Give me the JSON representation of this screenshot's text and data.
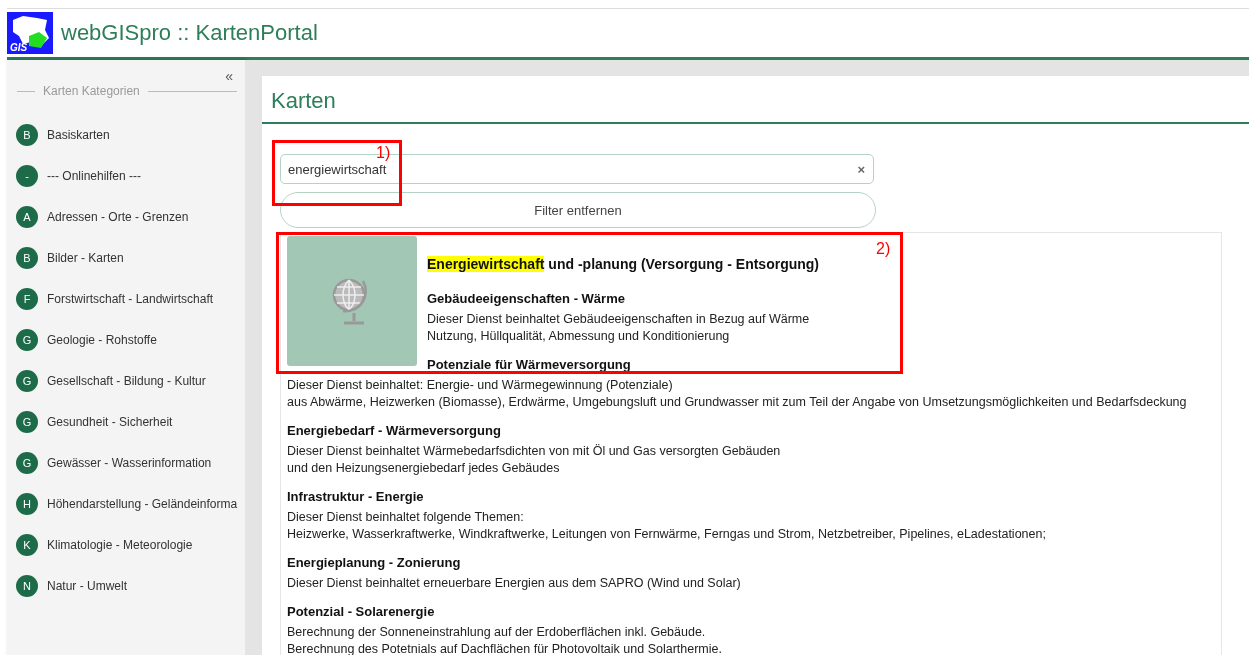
{
  "header": {
    "logo_text": "GIS",
    "title": "webGISpro :: KartenPortal"
  },
  "sidebar": {
    "collapse": "«",
    "heading": "Karten Kategorien",
    "items": [
      {
        "badge": "B",
        "label": "Basiskarten"
      },
      {
        "badge": "-",
        "label": "--- Onlinehilfen ---"
      },
      {
        "badge": "A",
        "label": "Adressen - Orte - Grenzen"
      },
      {
        "badge": "B",
        "label": "Bilder - Karten"
      },
      {
        "badge": "F",
        "label": "Forstwirtschaft - Landwirtschaft"
      },
      {
        "badge": "G",
        "label": "Geologie - Rohstoffe"
      },
      {
        "badge": "G",
        "label": "Gesellschaft - Bildung - Kultur"
      },
      {
        "badge": "G",
        "label": "Gesundheit - Sicherheit"
      },
      {
        "badge": "G",
        "label": "Gewässer - Wasserinformation"
      },
      {
        "badge": "H",
        "label": "Höhendarstellung - Geländeinforma"
      },
      {
        "badge": "K",
        "label": "Klimatologie - Meteorologie"
      },
      {
        "badge": "N",
        "label": "Natur - Umwelt"
      }
    ]
  },
  "main": {
    "title": "Karten",
    "search": {
      "value": "energiewirtschaft",
      "clear": "×"
    },
    "filter_button": "Filter entfernen",
    "result": {
      "title_highlight": "Energiewirtschaft",
      "title_rest": " und -planung (Versorgung - Entsorgung)",
      "sections": [
        {
          "heading": "Gebäudeeigenschaften - Wärme",
          "lines": [
            "Dieser Dienst beinhaltet Gebäudeeigenschaften in Bezug auf Wärme",
            "Nutzung, Hüllqualität, Abmessung und Konditionierung"
          ]
        },
        {
          "heading": "Potenziale für Wärmeversorgung",
          "lines": [
            "Dieser Dienst beinhaltet: Energie- und Wärmegewinnung (Potenziale)",
            "aus Abwärme, Heizwerken (Biomasse), Erdwärme, Umgebungsluft und Grundwasser mit zum Teil der Angabe von Umsetzungsmöglichkeiten und Bedarfsdeckung"
          ]
        },
        {
          "heading": "Energiebedarf - Wärmeversorgung",
          "lines": [
            "Dieser Dienst beinhaltet Wärmebedarfsdichten von mit Öl und Gas versorgten Gebäuden",
            "und den Heizungsenergiebedarf jedes Gebäudes"
          ]
        },
        {
          "heading": "Infrastruktur - Energie",
          "lines": [
            "Dieser Dienst beinhaltet folgende Themen:",
            "Heizwerke, Wasserkraftwerke, Windkraftwerke, Leitungen von Fernwärme, Ferngas und Strom, Netzbetreiber, Pipelines, eLadestationen;"
          ]
        },
        {
          "heading": "Energieplanung - Zonierung",
          "lines": [
            "Dieser Dienst beinhaltet erneuerbare Energien aus dem SAPRO (Wind und Solar)"
          ]
        },
        {
          "heading": "Potenzial - Solarenergie",
          "lines": [
            "Berechnung der Sonneneinstrahlung auf der Erdoberflächen inkl. Gebäude.",
            "Berechnung des Potetnials auf Dachflächen für Photovoltaik und Solarthermie."
          ]
        }
      ]
    }
  },
  "annotations": [
    {
      "label": "1)"
    },
    {
      "label": "2)"
    }
  ]
}
